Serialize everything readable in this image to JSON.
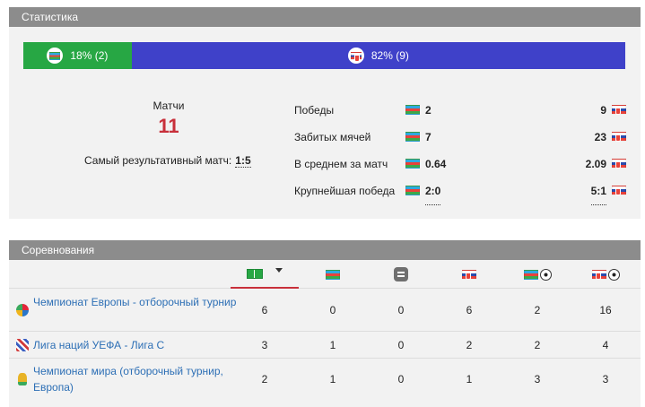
{
  "stats": {
    "title": "Статистика",
    "team_a": {
      "flag": "azerbaijan-flag",
      "bar_text": "18% (2)",
      "share": 0.18,
      "color": "#27a744"
    },
    "team_b": {
      "flag": "slovakia-flag",
      "bar_text": "82% (9)",
      "share": 0.82,
      "color": "#3f41c9"
    },
    "matches_label": "Матчи",
    "matches_value": "11",
    "best_match_label": "Самый результативный матч:",
    "best_match_value": "1:5",
    "rows": [
      {
        "label": "Победы",
        "a": "2",
        "b": "9"
      },
      {
        "label": "Забитых мячей",
        "a": "7",
        "b": "23"
      },
      {
        "label": "В среднем за матч",
        "a": "0.64",
        "b": "2.09"
      },
      {
        "label": "Крупнейшая победа",
        "a": "2:0",
        "b": "5:1"
      }
    ]
  },
  "competitions": {
    "title": "Соревнования",
    "columns": [
      "matches-field-icon",
      "azerbaijan-flag",
      "draw-icon",
      "slovakia-flag",
      "azerbaijan-goals-icon",
      "slovakia-goals-icon"
    ],
    "rows": [
      {
        "icon": "euro-cup-icon",
        "name": "Чемпионат Европы - отборочный турнир",
        "values": [
          "6",
          "0",
          "0",
          "6",
          "2",
          "16"
        ]
      },
      {
        "icon": "nations-league-icon",
        "name": "Лига наций УЕФА - Лига C",
        "values": [
          "3",
          "1",
          "0",
          "2",
          "2",
          "4"
        ]
      },
      {
        "icon": "world-cup-icon",
        "name": "Чемпионат мира (отборочный турнир, Европа)",
        "values": [
          "2",
          "1",
          "0",
          "1",
          "3",
          "3"
        ]
      }
    ]
  }
}
